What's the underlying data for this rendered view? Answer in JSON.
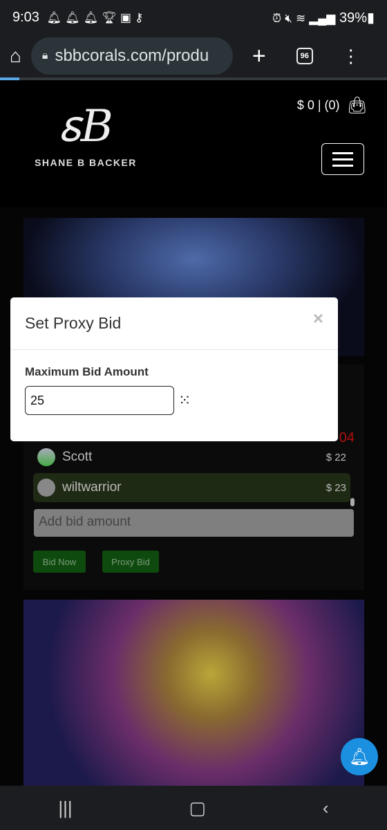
{
  "status_bar": {
    "time": "9:03",
    "left_icons": [
      "bell-icon",
      "bell-icon",
      "bell-icon",
      "trophy-icon",
      "speaker-icon",
      "key-icon"
    ],
    "right_icons": [
      "alarm-icon",
      "mute-icon",
      "wifi-icon",
      "signal-icon"
    ],
    "battery": "39%"
  },
  "browser": {
    "url": "sbbcorals.com/produ",
    "tab_count": "96"
  },
  "site": {
    "logo_mark": "SB",
    "logo_name": "SHANE B BACKER",
    "cart": "$ 0 | (0)"
  },
  "auction": {
    "timer": "04",
    "bids": [
      {
        "name": "Scott",
        "amount": "$ 22"
      },
      {
        "name": "wiltwarrior",
        "amount": "$ 23"
      }
    ],
    "add_bid_placeholder": "Add bid amount",
    "bid_now": "Bid Now",
    "proxy_bid": "Proxy Bid"
  },
  "modal": {
    "title": "Set Proxy Bid",
    "close": "×",
    "label": "Maximum Bid Amount",
    "value": "25"
  },
  "colors": {
    "bid_highlight": "#1f2a14",
    "button_green": "#0e4a0e",
    "bell": "#1b8fe0"
  }
}
